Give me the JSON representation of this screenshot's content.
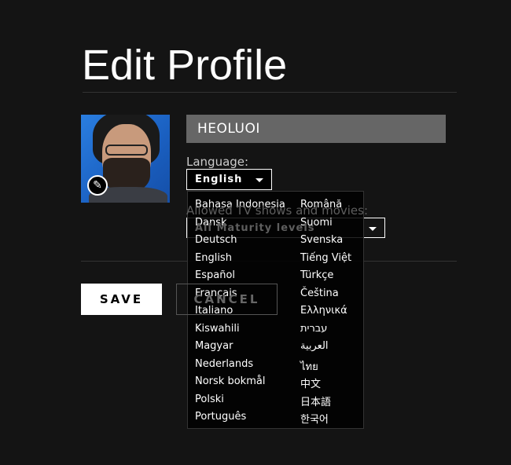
{
  "page": {
    "title": "Edit Profile"
  },
  "profile": {
    "name": "HEOLUOI",
    "avatar": "profile-avatar-image",
    "edit_icon": "pencil-icon"
  },
  "language": {
    "label": "Language:",
    "selected": "English"
  },
  "maturity": {
    "label": "Allowed TV shows and movies:",
    "selected": "All Maturity levels"
  },
  "buttons": {
    "save": "SAVE",
    "cancel": "CANCEL"
  },
  "language_options": {
    "left": [
      "Bahasa Indonesia",
      "Dansk",
      "Deutsch",
      "English",
      "Español",
      "Français",
      "Italiano",
      "Kiswahili",
      "Magyar",
      "Nederlands",
      "Norsk bokmål",
      "Polski",
      "Português"
    ],
    "right": [
      "Română",
      "Suomi",
      "Svenska",
      "Tiếng Việt",
      "Türkçe",
      "Čeština",
      "Ελληνικά",
      "עברית",
      "العربية",
      "ไทย",
      "中文",
      "日本語",
      "한국어"
    ]
  },
  "colors": {
    "background": "#141414",
    "input": "#666666",
    "menu": "#000000"
  }
}
